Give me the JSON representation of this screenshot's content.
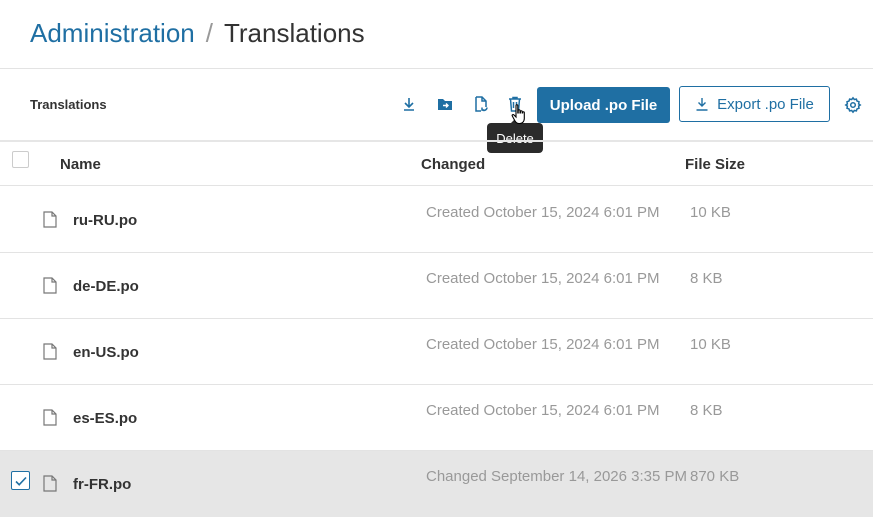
{
  "breadcrumb": {
    "parent": "Administration",
    "separator": "/",
    "current": "Translations"
  },
  "toolbar": {
    "title": "Translations",
    "upload_label": "Upload .po File",
    "export_label": "Export .po File",
    "tooltip": "Delete"
  },
  "table": {
    "columns": [
      "Name",
      "Changed",
      "File Size"
    ],
    "rows": [
      {
        "name": "ru-RU.po",
        "changed": "Created October 15, 2024 6:01 PM",
        "size": "10 KB",
        "selected": false
      },
      {
        "name": "de-DE.po",
        "changed": "Created October 15, 2024 6:01 PM",
        "size": "8 KB",
        "selected": false
      },
      {
        "name": "en-US.po",
        "changed": "Created October 15, 2024 6:01 PM",
        "size": "10 KB",
        "selected": false
      },
      {
        "name": "es-ES.po",
        "changed": "Created October 15, 2024 6:01 PM",
        "size": "8 KB",
        "selected": false
      },
      {
        "name": "fr-FR.po",
        "changed": "Changed September 14, 2026 3:35 PM",
        "size": "870 KB",
        "selected": true
      }
    ]
  },
  "icons": [
    "download-icon",
    "move-to-folder-icon",
    "replace-file-icon",
    "trash-icon",
    "export-download-icon",
    "settings-gear-icon",
    "file-icon",
    "checkmark-icon"
  ],
  "colors": {
    "accent": "#1f6fa3",
    "selected_row": "#e6e6e6",
    "muted_text": "#999999"
  }
}
